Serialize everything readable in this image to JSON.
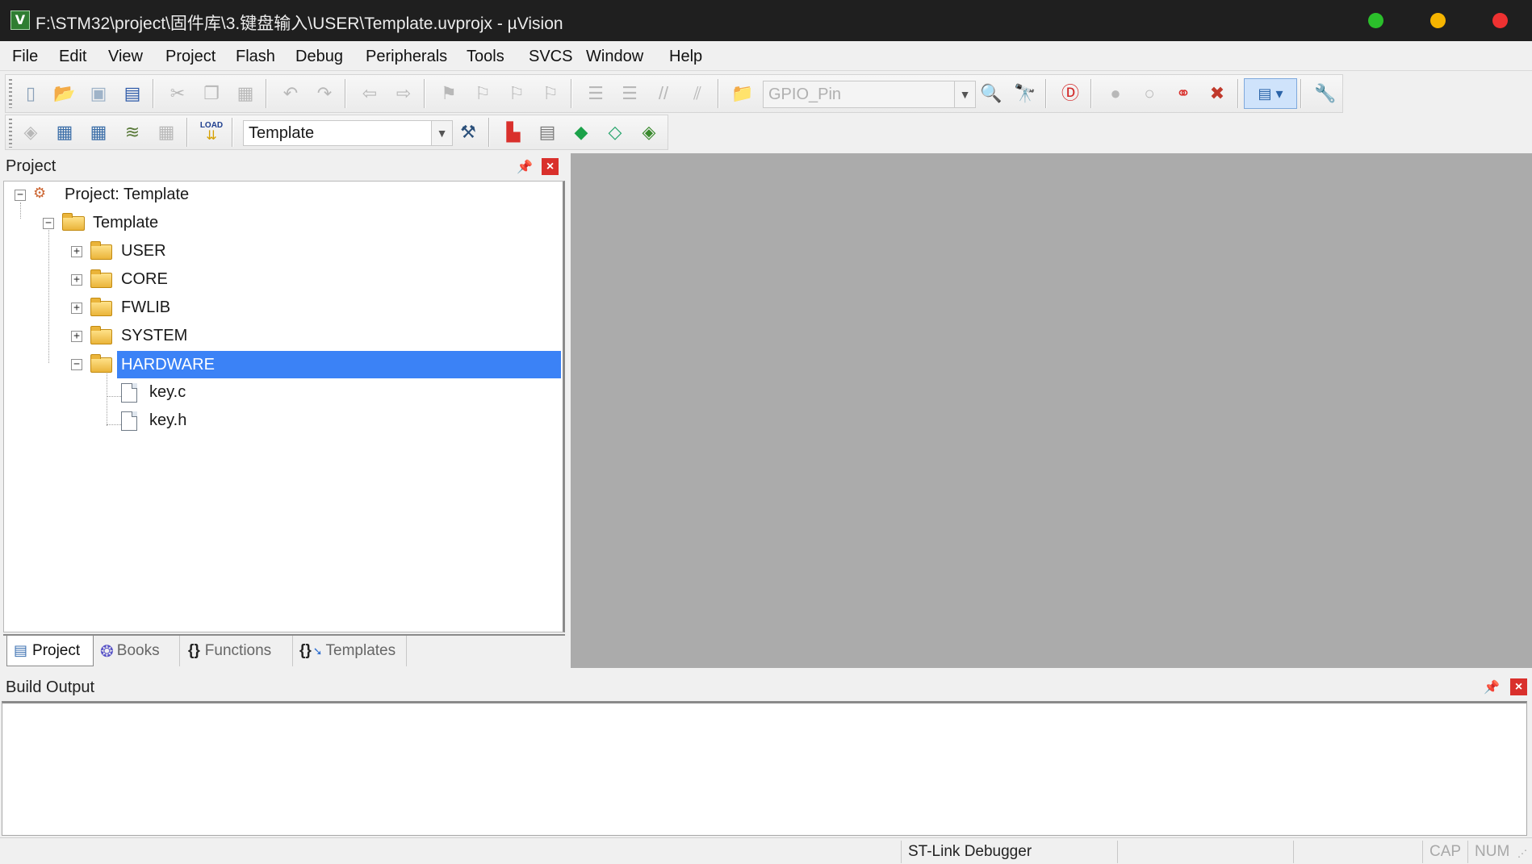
{
  "window": {
    "title": "F:\\STM32\\project\\固件库\\3.键盘输入\\USER\\Template.uvprojx - µVision",
    "app_icon": "uvision-icon",
    "controls": {
      "colors": {
        "green": "#2bbf2b",
        "yellow": "#f5b400",
        "red": "#ee3131"
      }
    }
  },
  "menu": [
    "File",
    "Edit",
    "View",
    "Project",
    "Flash",
    "Debug",
    "Peripherals",
    "Tools",
    "SVCS",
    "Window",
    "Help"
  ],
  "toolbar1": {
    "find_combo_value": "GPIO_Pin",
    "icons": [
      "new-file-icon",
      "open-file-icon",
      "save-icon",
      "save-all-icon",
      "cut-icon",
      "copy-icon",
      "paste-icon",
      "undo-icon",
      "redo-icon",
      "navigate-back-icon",
      "navigate-forward-icon",
      "bookmark-icon",
      "prev-bookmark-icon",
      "next-bookmark-icon",
      "clear-bookmarks-icon",
      "indent-icon",
      "unindent-icon",
      "comment-icon",
      "uncomment-icon",
      "find-in-files-icon",
      "find-icon",
      "incremental-find-icon",
      "debug-session-icon",
      "insert-breakpoint-icon",
      "enable-breakpoint-icon",
      "disable-breakpoints-icon",
      "kill-breakpoints-icon",
      "window-layout-icon",
      "configure-icon"
    ]
  },
  "toolbar2": {
    "target_combo_value": "Template",
    "icons": [
      "translate-icon",
      "build-icon",
      "rebuild-icon",
      "batch-build-icon",
      "stop-build-icon",
      "load-download-icon",
      "target-options-icon",
      "manage-components-icon",
      "select-packs-icon",
      "pack-installer-icon",
      "run-time-environment-icon"
    ],
    "load_label": "LOAD"
  },
  "project_panel": {
    "title": "Project",
    "tree": [
      {
        "label": "Project: Template",
        "level": 0,
        "expanded": true,
        "kind": "project"
      },
      {
        "label": "Template",
        "level": 1,
        "expanded": true,
        "kind": "target"
      },
      {
        "label": "USER",
        "level": 2,
        "expanded": false,
        "kind": "folder"
      },
      {
        "label": "CORE",
        "level": 2,
        "expanded": false,
        "kind": "folder"
      },
      {
        "label": "FWLIB",
        "level": 2,
        "expanded": false,
        "kind": "folder"
      },
      {
        "label": "SYSTEM",
        "level": 2,
        "expanded": false,
        "kind": "folder"
      },
      {
        "label": "HARDWARE",
        "level": 2,
        "expanded": true,
        "kind": "folder",
        "selected": true
      },
      {
        "label": "key.c",
        "level": 3,
        "kind": "file"
      },
      {
        "label": "key.h",
        "level": 3,
        "kind": "file"
      }
    ],
    "tabs": [
      {
        "label": "Project",
        "active": true,
        "icon": "project-tab-icon"
      },
      {
        "label": "Books",
        "active": false,
        "icon": "books-icon"
      },
      {
        "label": "Functions",
        "active": false,
        "icon": "functions-icon"
      },
      {
        "label": "Templates",
        "active": false,
        "icon": "templates-icon"
      }
    ],
    "functions_glyph": "{}",
    "templates_glyph": "{}"
  },
  "build_output": {
    "title": "Build Output",
    "content": ""
  },
  "status_bar": {
    "debugger": "ST-Link Debugger",
    "cap": "CAP",
    "num": "NUM"
  },
  "accent_color": "#3b82f6"
}
